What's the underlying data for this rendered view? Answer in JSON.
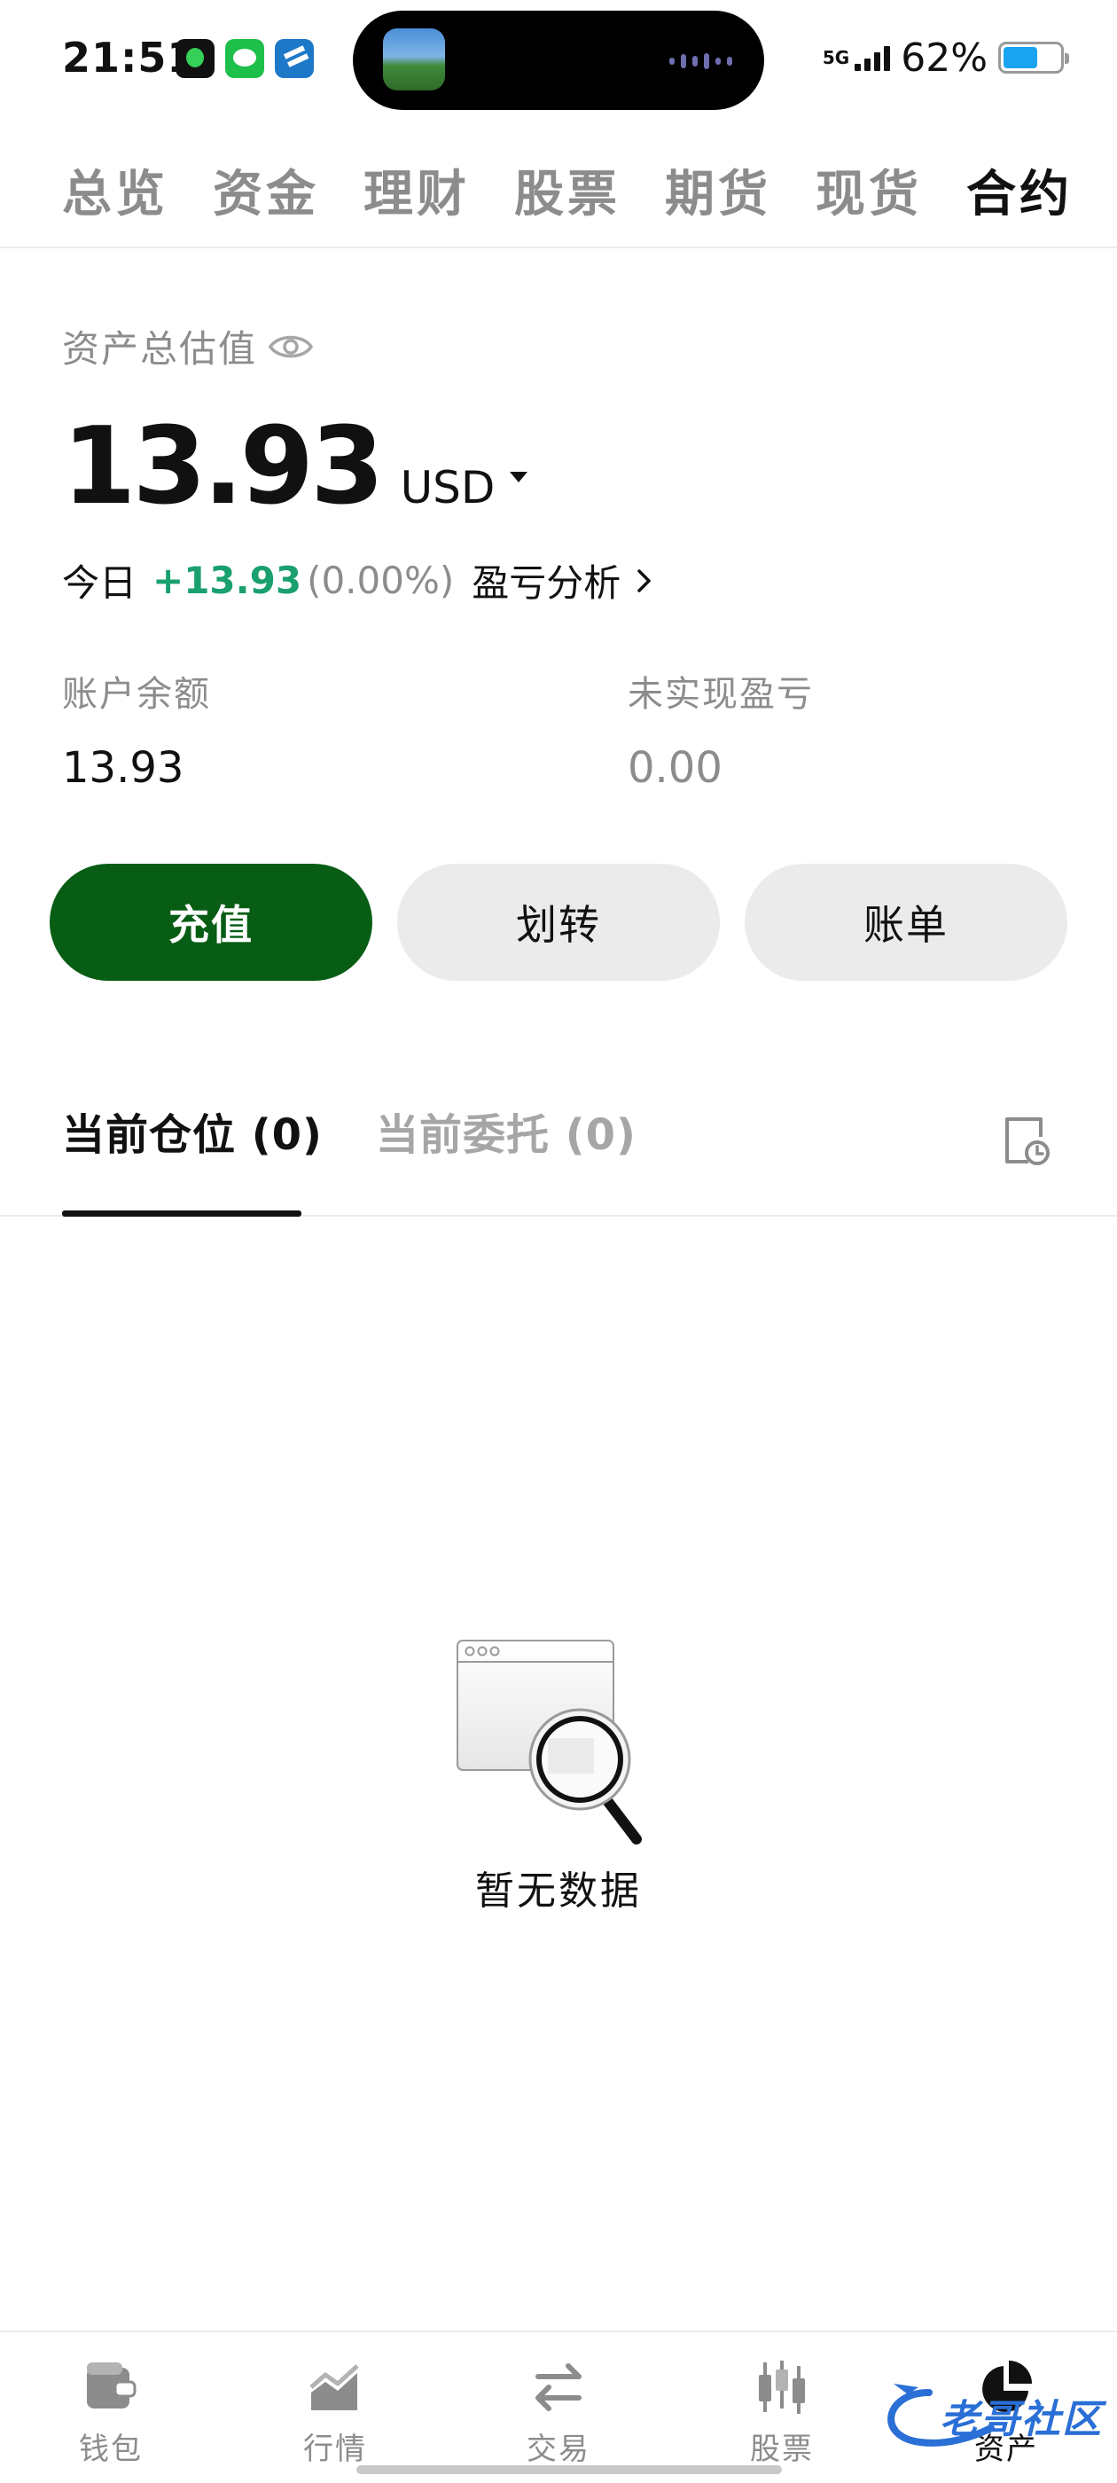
{
  "status_bar": {
    "time": "21:51",
    "network": "5G",
    "battery_percent": "62%",
    "battery_level": 0.62
  },
  "top_tabs": [
    {
      "label": "总览",
      "active": false
    },
    {
      "label": "资金",
      "active": false
    },
    {
      "label": "理财",
      "active": false
    },
    {
      "label": "股票",
      "active": false
    },
    {
      "label": "期货",
      "active": false
    },
    {
      "label": "现货",
      "active": false
    },
    {
      "label": "合约",
      "active": true
    }
  ],
  "asset": {
    "label": "资产总估值",
    "value": "13.93",
    "currency": "USD",
    "today_label": "今日",
    "today_pnl": "+13.93",
    "today_pct": "(0.00%)",
    "pnl_analysis": "盈亏分析"
  },
  "stats": {
    "balance_label": "账户余额",
    "balance_value": "13.93",
    "unrealized_label": "未实现盈亏",
    "unrealized_value": "0.00"
  },
  "actions": {
    "deposit": "充值",
    "transfer": "划转",
    "bill": "账单"
  },
  "position_tabs": {
    "current_positions": "当前仓位 (0)",
    "current_orders": "当前委托 (0)"
  },
  "empty_state": {
    "text": "暂无数据"
  },
  "bottom_nav": [
    {
      "label": "钱包",
      "icon": "wallet-icon"
    },
    {
      "label": "行情",
      "icon": "market-chart-icon"
    },
    {
      "label": "交易",
      "icon": "trade-swap-icon"
    },
    {
      "label": "股票",
      "icon": "candlestick-icon"
    },
    {
      "label": "资产",
      "icon": "pie-chart-icon",
      "active": true
    }
  ],
  "watermark": {
    "text": "老哥社区"
  },
  "colors": {
    "brand_green": "#075d14",
    "profit_green": "#1aa06f",
    "muted_gray": "#8c8c8c",
    "button_gray": "#ebebeb"
  }
}
